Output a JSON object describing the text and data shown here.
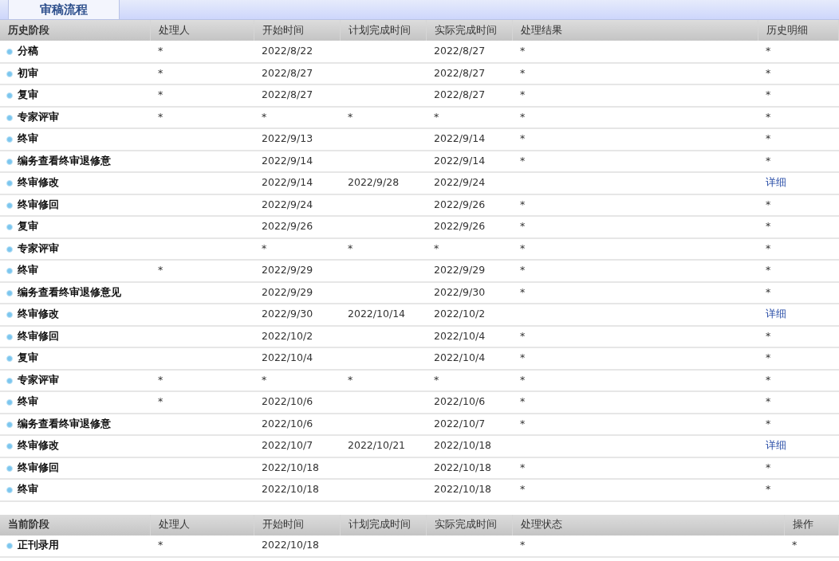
{
  "tabs": [
    {
      "label": "审稿流程",
      "selected": true
    }
  ],
  "history": {
    "columns": [
      "历史阶段",
      "处理人",
      "开始时间",
      "计划完成时间",
      "实际完成时间",
      "处理结果",
      "历史明细"
    ],
    "rows": [
      {
        "stage": "分稿",
        "handler": "*",
        "start": "2022/8/22",
        "planned": "",
        "actual": "2022/8/27",
        "result": "*",
        "detail": {
          "kind": "text",
          "text": "*"
        }
      },
      {
        "stage": "初审",
        "handler": "*",
        "start": "2022/8/27",
        "planned": "",
        "actual": "2022/8/27",
        "result": "*",
        "detail": {
          "kind": "text",
          "text": "*"
        }
      },
      {
        "stage": "复审",
        "handler": "*",
        "start": "2022/8/27",
        "planned": "",
        "actual": "2022/8/27",
        "result": "*",
        "detail": {
          "kind": "text",
          "text": "*"
        }
      },
      {
        "stage": "专家评审",
        "handler": "*",
        "start": "*",
        "planned": "*",
        "actual": "*",
        "result": "*",
        "detail": {
          "kind": "text",
          "text": "*"
        }
      },
      {
        "stage": "终审",
        "handler": "",
        "start": "2022/9/13",
        "planned": "",
        "actual": "2022/9/14",
        "result": "*",
        "detail": {
          "kind": "text",
          "text": "*"
        }
      },
      {
        "stage": "编务查看终审退修意",
        "handler": "",
        "start": "2022/9/14",
        "planned": "",
        "actual": "2022/9/14",
        "result": "*",
        "detail": {
          "kind": "text",
          "text": "*"
        }
      },
      {
        "stage": "终审修改",
        "handler": "",
        "start": "2022/9/14",
        "planned": "2022/9/28",
        "actual": "2022/9/24",
        "result": "",
        "detail": {
          "kind": "link",
          "text": "详细"
        }
      },
      {
        "stage": "终审修回",
        "handler": "",
        "start": "2022/9/24",
        "planned": "",
        "actual": "2022/9/26",
        "result": "*",
        "detail": {
          "kind": "text",
          "text": "*"
        }
      },
      {
        "stage": "复审",
        "handler": "",
        "start": "2022/9/26",
        "planned": "",
        "actual": "2022/9/26",
        "result": "*",
        "detail": {
          "kind": "text",
          "text": "*"
        }
      },
      {
        "stage": "专家评审",
        "handler": "",
        "start": "*",
        "planned": "*",
        "actual": "*",
        "result": "*",
        "detail": {
          "kind": "text",
          "text": "*"
        }
      },
      {
        "stage": "终审",
        "handler": "*",
        "start": "2022/9/29",
        "planned": "",
        "actual": "2022/9/29",
        "result": "*",
        "detail": {
          "kind": "text",
          "text": "*"
        }
      },
      {
        "stage": "编务查看终审退修意见",
        "handler": "",
        "start": "2022/9/29",
        "planned": "",
        "actual": "2022/9/30",
        "result": "*",
        "detail": {
          "kind": "text",
          "text": "*"
        }
      },
      {
        "stage": "终审修改",
        "handler": "",
        "start": "2022/9/30",
        "planned": "2022/10/14",
        "actual": "2022/10/2",
        "result": "",
        "detail": {
          "kind": "link",
          "text": "详细"
        }
      },
      {
        "stage": "终审修回",
        "handler": "",
        "start": "2022/10/2",
        "planned": "",
        "actual": "2022/10/4",
        "result": "*",
        "detail": {
          "kind": "text",
          "text": "*"
        }
      },
      {
        "stage": "复审",
        "handler": "",
        "start": "2022/10/4",
        "planned": "",
        "actual": "2022/10/4",
        "result": "*",
        "detail": {
          "kind": "text",
          "text": "*"
        }
      },
      {
        "stage": "专家评审",
        "handler": "*",
        "start": "*",
        "planned": "*",
        "actual": "*",
        "result": "*",
        "detail": {
          "kind": "text",
          "text": "*"
        }
      },
      {
        "stage": "终审",
        "handler": "*",
        "start": "2022/10/6",
        "planned": "",
        "actual": "2022/10/6",
        "result": "*",
        "detail": {
          "kind": "text",
          "text": "*"
        }
      },
      {
        "stage": "编务查看终审退修意",
        "handler": "",
        "start": "2022/10/6",
        "planned": "",
        "actual": "2022/10/7",
        "result": "*",
        "detail": {
          "kind": "text",
          "text": "*"
        }
      },
      {
        "stage": "终审修改",
        "handler": "",
        "start": "2022/10/7",
        "planned": "2022/10/21",
        "actual": "2022/10/18",
        "result": "",
        "detail": {
          "kind": "link",
          "text": "详细"
        }
      },
      {
        "stage": "终审修回",
        "handler": "",
        "start": "2022/10/18",
        "planned": "",
        "actual": "2022/10/18",
        "result": "*",
        "detail": {
          "kind": "text",
          "text": "*"
        }
      },
      {
        "stage": "终审",
        "handler": "",
        "start": "2022/10/18",
        "planned": "",
        "actual": "2022/10/18",
        "result": "*",
        "detail": {
          "kind": "text",
          "text": "*"
        }
      }
    ]
  },
  "current": {
    "columns": [
      "当前阶段",
      "处理人",
      "开始时间",
      "计划完成时间",
      "实际完成时间",
      "处理状态",
      "操作"
    ],
    "rows": [
      {
        "stage": "正刊录用",
        "handler": "*",
        "start": "2022/10/18",
        "planned": "",
        "actual": "",
        "result": "*",
        "detail": {
          "kind": "text",
          "text": "*"
        }
      }
    ]
  }
}
